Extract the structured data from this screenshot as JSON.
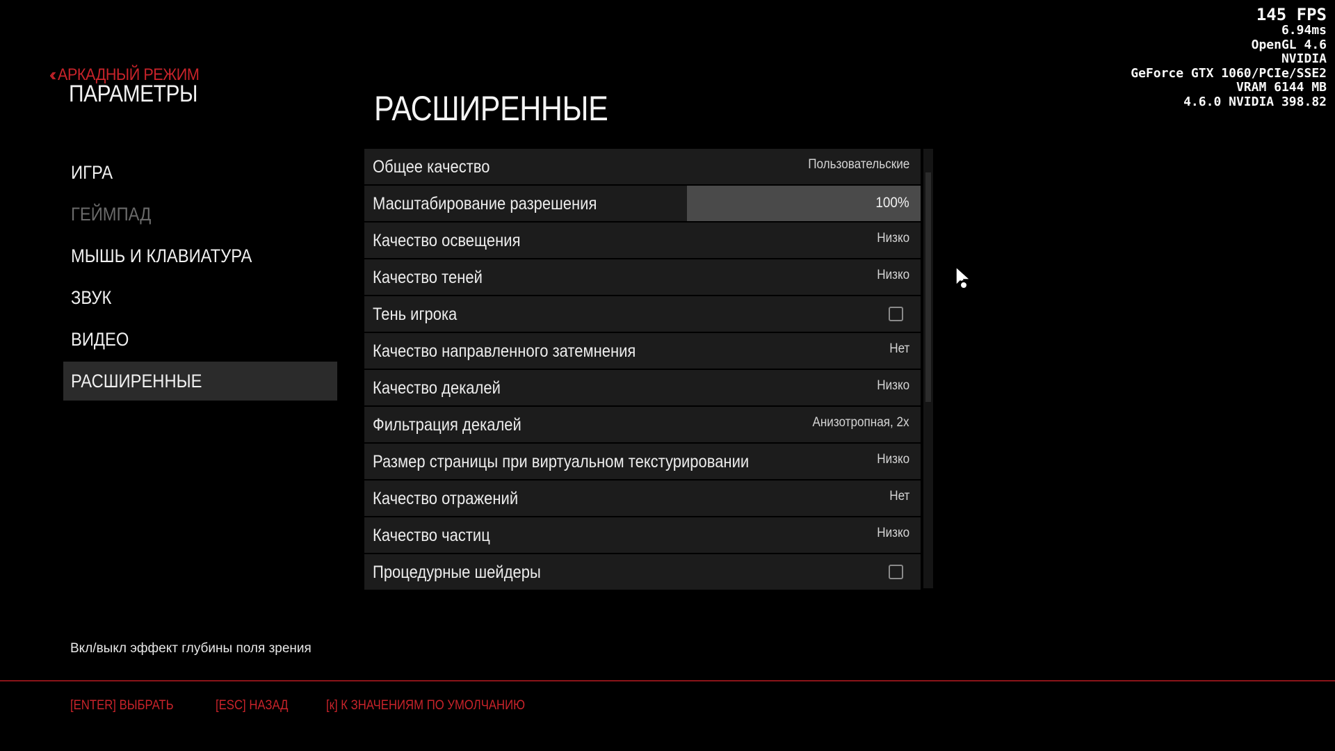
{
  "header": {
    "back_label": "АРКАДНЫЙ РЕЖИМ",
    "parent_title": "ПАРАМЕТРЫ",
    "section_title": "РАСШИРЕННЫЕ"
  },
  "sidebar": {
    "items": [
      {
        "label": "ИГРА",
        "state": "normal"
      },
      {
        "label": "ГЕЙМПАД",
        "state": "disabled"
      },
      {
        "label": "МЫШЬ И КЛАВИАТУРА",
        "state": "normal"
      },
      {
        "label": "ЗВУК",
        "state": "normal"
      },
      {
        "label": "ВИДЕО",
        "state": "normal"
      },
      {
        "label": "РАСШИРЕННЫЕ",
        "state": "active"
      }
    ]
  },
  "settings": [
    {
      "label": "Общее качество",
      "type": "option",
      "value": "Пользовательские"
    },
    {
      "label": "Масштабирование разрешения",
      "type": "slider",
      "value": "100%",
      "level": 1.0
    },
    {
      "label": "Качество освещения",
      "type": "option",
      "value": "Низко"
    },
    {
      "label": "Качество теней",
      "type": "option",
      "value": "Низко"
    },
    {
      "label": "Тень игрока",
      "type": "checkbox",
      "checked": false
    },
    {
      "label": "Качество направленного затемнения",
      "type": "option",
      "value": "Нет"
    },
    {
      "label": "Качество декалей",
      "type": "option",
      "value": "Низко"
    },
    {
      "label": "Фильтрация декалей",
      "type": "option",
      "value": "Анизотропная, 2x"
    },
    {
      "label": "Размер страницы при виртуальном текстурировании",
      "type": "option",
      "value": "Низко"
    },
    {
      "label": "Качество отражений",
      "type": "option",
      "value": "Нет"
    },
    {
      "label": "Качество частиц",
      "type": "option",
      "value": "Низко"
    },
    {
      "label": "Процедурные шейдеры",
      "type": "checkbox",
      "checked": false
    }
  ],
  "stats": {
    "fps": "145 FPS",
    "frametime": "6.94ms",
    "api": "OpenGL 4.6",
    "vendor": "NVIDIA",
    "gpu": "GeForce GTX 1060/PCIe/SSE2",
    "vram": "VRAM 6144 MB",
    "driver": "4.6.0 NVIDIA 398.82"
  },
  "hint": "Вкл/выкл эффект глубины поля зрения",
  "footer": {
    "select": "[ENTER] ВЫБРАТЬ",
    "back": "[ESC] НАЗАД",
    "defaults": "[к] К ЗНАЧЕНИЯМ ПО УМОЛЧАНИЮ"
  },
  "colors": {
    "accent": "#c8232a",
    "row_bg": "#1c1c1c",
    "active_nav_bg": "#2b2b2b"
  }
}
